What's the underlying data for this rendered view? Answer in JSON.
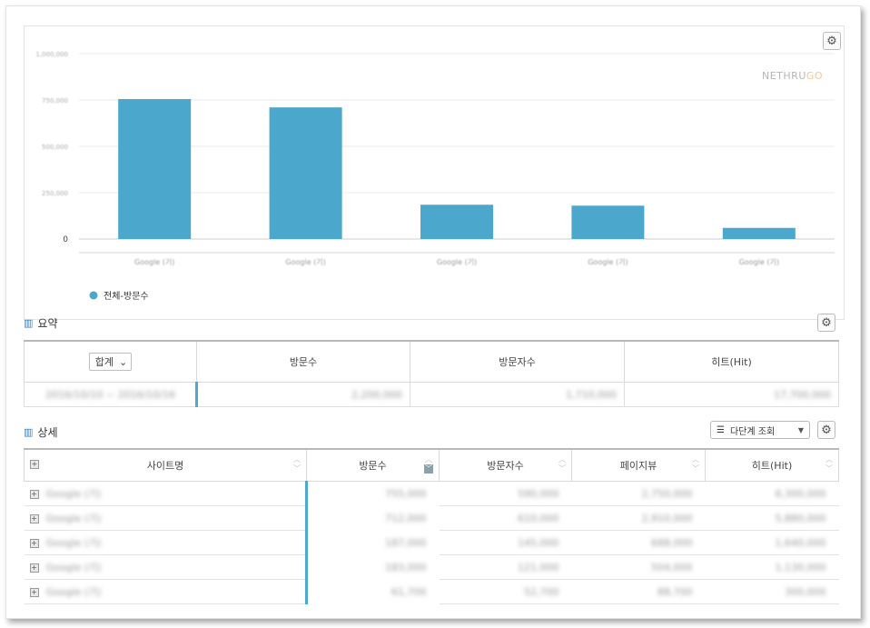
{
  "chart_data": {
    "type": "bar",
    "categories": [
      "Google (기)",
      "Google (기)",
      "Google (기)",
      "Google (기)",
      "Google (기)"
    ],
    "series": [
      {
        "name": "전체-방문수",
        "values": [
          755000,
          710000,
          185000,
          180000,
          60000
        ]
      }
    ],
    "y_ticks": [
      "1,000,000",
      "750,000",
      "500,000",
      "250,000",
      "0"
    ],
    "ylim": [
      0,
      1000000
    ],
    "grid": true,
    "legend_position": "bottom-left",
    "bar_color": "#4ba7cb"
  },
  "logo": {
    "main": "NETHRU",
    "accent": "GO"
  },
  "icons": {
    "settings": "gear-icon",
    "section": "bar-chart-icon",
    "expand": "plus-icon",
    "sort": "sort-arrows-icon",
    "list": "list-icon",
    "dropdown": "caret-down-icon"
  },
  "summary": {
    "title": "요약",
    "select_value": "합계",
    "columns": [
      "방문수",
      "방문자수",
      "히트(Hit)"
    ],
    "row": {
      "date_range": "2016/10/10 ~ 2016/10/16",
      "visits": "2,200,000",
      "visitors": "1,710,000",
      "hits": "17,700,000"
    }
  },
  "detail": {
    "title": "상세",
    "multi_button_label": "다단계 조회",
    "columns": [
      "사이트명",
      "방문수",
      "방문자수",
      "페이지뷰",
      "히트(Hit)"
    ],
    "rows": [
      {
        "name": "Google (기)",
        "visits": "755,000",
        "visitors": "590,000",
        "pageviews": "2,750,000",
        "hits": "6,300,000"
      },
      {
        "name": "Google (기)",
        "visits": "712,000",
        "visitors": "610,000",
        "pageviews": "2,910,000",
        "hits": "5,880,000"
      },
      {
        "name": "Google (기)",
        "visits": "187,000",
        "visitors": "145,000",
        "pageviews": "688,000",
        "hits": "1,640,000"
      },
      {
        "name": "Google (기)",
        "visits": "183,000",
        "visitors": "121,000",
        "pageviews": "504,000",
        "hits": "1,130,000"
      },
      {
        "name": "Google (기)",
        "visits": "61,700",
        "visitors": "52,700",
        "pageviews": "88,700",
        "hits": "300,000"
      }
    ]
  }
}
